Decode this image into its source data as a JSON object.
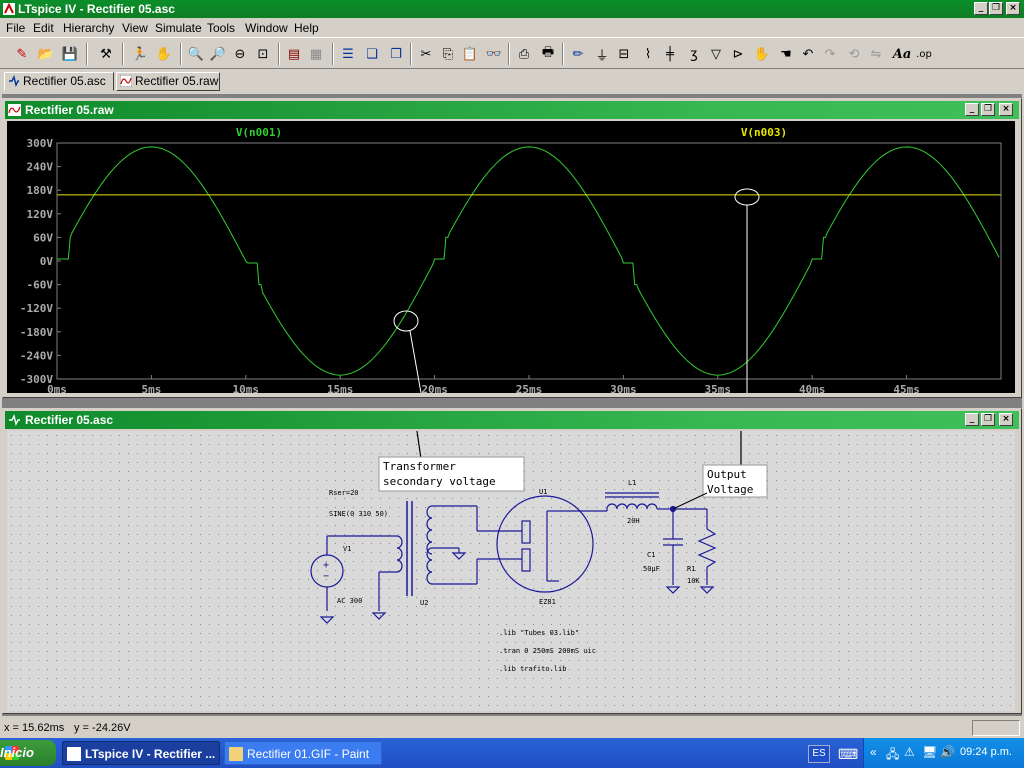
{
  "window": {
    "title": "LTspice IV - Rectifier 05.asc"
  },
  "menu": [
    "File",
    "Edit",
    "Hierarchy",
    "View",
    "Simulate",
    "Tools",
    "Window",
    "Help"
  ],
  "tabs": [
    {
      "label": "Rectifier 05.asc"
    },
    {
      "label": "Rectifier 05.raw"
    }
  ],
  "waveform_window": {
    "title": "Rectifier 05.raw",
    "trace_labels": [
      "V(n001)",
      "V(n003)"
    ],
    "trace_colors": {
      "V(n001)": "#33cc33",
      "V(n003)": "#e6e600"
    },
    "annotation_marks": 2
  },
  "chart_data": {
    "type": "line",
    "xlabel": "",
    "ylabel": "",
    "x_ticks": [
      "0ms",
      "5ms",
      "10ms",
      "15ms",
      "20ms",
      "25ms",
      "30ms",
      "35ms",
      "40ms",
      "45ms"
    ],
    "y_ticks": [
      "300V",
      "240V",
      "180V",
      "120V",
      "60V",
      "0V",
      "-60V",
      "-120V",
      "-180V",
      "-240V",
      "-300V"
    ],
    "xlim": [
      0,
      50
    ],
    "ylim": [
      -300,
      300
    ],
    "grid": false,
    "series": [
      {
        "name": "V(n001)",
        "color": "#33cc33",
        "kind": "sine",
        "amplitude": 290,
        "period_ms": 20,
        "x": [
          0,
          2.5,
          5,
          7.5,
          10,
          12.5,
          15,
          17.5,
          20,
          22.5,
          25,
          27.5,
          30,
          32.5,
          35,
          37.5,
          40,
          42.5,
          45,
          47.5,
          50
        ],
        "y": [
          5,
          205,
          290,
          205,
          5,
          -205,
          -290,
          -205,
          -5,
          205,
          290,
          205,
          5,
          -205,
          -290,
          -205,
          -5,
          205,
          290,
          205,
          5
        ]
      },
      {
        "name": "V(n003)",
        "color": "#e6e600",
        "x": [
          0,
          50
        ],
        "y": [
          168,
          168
        ]
      }
    ]
  },
  "schematic_window": {
    "title": "Rectifier 05.asc",
    "labels": {
      "rser": "Rser=20",
      "sine": "SINE(0 310 50)",
      "v1": "V1",
      "ac": "AC 300",
      "u2": "U2",
      "u1": "U1",
      "tube": "EZ81",
      "l1": "L1",
      "l1val": "20H",
      "c1": "C1",
      "c1val": "50µF",
      "r1": "R1",
      "r1val": "10K",
      "dir1": ".lib \"Tubes 03.lib\"",
      "dir2": ".tran 0 250mS 200mS uic",
      "dir3": ".lib trafito.lib"
    },
    "callouts": [
      {
        "lines": [
          "Transformer",
          "secondary voltage"
        ]
      },
      {
        "lines": [
          "Output",
          "Voltage"
        ]
      }
    ]
  },
  "status": {
    "x": "x = 15.62ms",
    "y": "y = -24.26V"
  },
  "taskbar": {
    "start": "Inicio",
    "tasks": [
      "LTspice IV - Rectifier ...",
      "Rectifier 01.GIF - Paint"
    ],
    "lang": "ES",
    "time": "09:24 p.m."
  }
}
